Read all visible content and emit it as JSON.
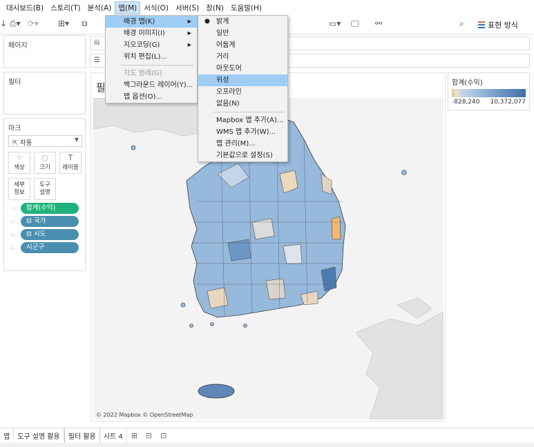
{
  "menubar": {
    "items": [
      "대시보드(B)",
      "스토리(T)",
      "분석(A)",
      "맵(M)",
      "서식(O)",
      "서버(S)",
      "창(N)",
      "도움말(H)"
    ],
    "active_index": 3
  },
  "toolbar": {
    "show_me_label": "표현 방식"
  },
  "panels": {
    "pages_label": "페이지",
    "filters_label": "필터",
    "marks_label": "마크",
    "mark_type": "자동",
    "buttons": {
      "color": "색상",
      "size": "크기",
      "label": "레이블",
      "detail_l1": "세부",
      "detail_l2": "정보",
      "tooltip_l1": "도구",
      "tooltip_l2": "설명"
    },
    "mark_pills": [
      "합계(수익)",
      "⊟ 국가",
      "⊟ 시도",
      "시군구"
    ]
  },
  "shelves": {
    "columns_icon": "iii",
    "rows_icon": "☰"
  },
  "canvas": {
    "title_fragment": "필",
    "attribution": "© 2022 Mapbox © OpenStreetMap"
  },
  "legend": {
    "title": "합계(수익)",
    "min_label": "-828,240",
    "max_label": "10,372,077",
    "min_value": -828240,
    "max_value": 10372077,
    "color_negative": "#e8c48f",
    "color_low": "#c9d7e8",
    "color_high": "#3e6ea6"
  },
  "map_menu": {
    "items": [
      {
        "label": "배경 맵(K)",
        "submenu": true,
        "highlighted": true
      },
      {
        "label": "배경 이미지(I)",
        "submenu": true
      },
      {
        "label": "지오코딩(G)",
        "submenu": true
      },
      {
        "label": "위치 편집(L)..."
      },
      {
        "separator": true
      },
      {
        "label": "지도 범례(G)",
        "disabled": true
      },
      {
        "label": "백그라운드 레이어(Y)..."
      },
      {
        "label": "맵 옵션(O)..."
      }
    ]
  },
  "background_map_menu": {
    "items": [
      {
        "label": "밝게",
        "checked": true
      },
      {
        "label": "일반"
      },
      {
        "label": "어둡게"
      },
      {
        "label": "거리"
      },
      {
        "label": "아웃도어"
      },
      {
        "label": "위성",
        "highlighted": true
      },
      {
        "label": "오프라인"
      },
      {
        "label": "없음(N)"
      },
      {
        "separator": true
      },
      {
        "label": "Mapbox 맵 추가(A)..."
      },
      {
        "label": "WMS 맵 추가(W)..."
      },
      {
        "label": "맵 관리(M)..."
      },
      {
        "label": "기본값으로 설정(S)"
      }
    ]
  },
  "tabs": {
    "items": [
      "맵",
      "도구 설명 활용",
      "필터 활용",
      "시트 4"
    ],
    "active_index": 2
  }
}
